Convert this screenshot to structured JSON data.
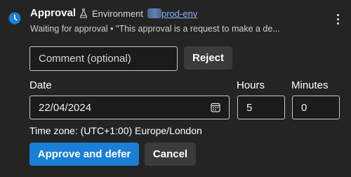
{
  "header": {
    "title": "Approval",
    "environment_label": "Environment",
    "environment_link": "prod-env",
    "subtitle": "Waiting for approval • \"This approval is a request to make a de..."
  },
  "comment": {
    "placeholder": "Comment (optional)"
  },
  "buttons": {
    "reject": "Reject",
    "approve": "Approve and defer",
    "cancel": "Cancel"
  },
  "schedule": {
    "date_label": "Date",
    "date_value": "22/04/2024",
    "hours_label": "Hours",
    "hours_value": "5",
    "minutes_label": "Minutes",
    "minutes_value": "0",
    "timezone": "Time zone: (UTC+1:00) Europe/London"
  },
  "icons": {
    "status": "clock-icon",
    "environment": "flask-icon",
    "date_picker": "calendar-icon",
    "menu": "more-vertical-icon"
  },
  "colors": {
    "background": "#242424",
    "status_icon": "#1a7fd6",
    "primary_button": "#1a7fd6",
    "link": "#8ab4f8"
  }
}
